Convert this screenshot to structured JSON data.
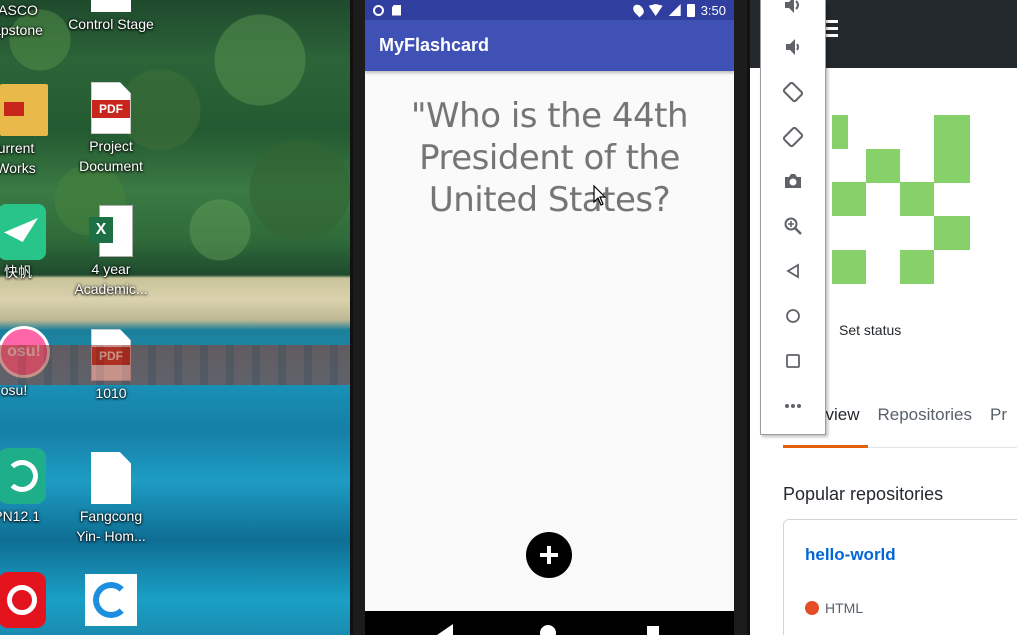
{
  "desktop": {
    "icons": [
      {
        "label": "ASCO\napstone"
      },
      {
        "label": "Control Stage"
      },
      {
        "label": "urrent\nWorks"
      },
      {
        "label": "Project\nDocument"
      },
      {
        "label": "快帆"
      },
      {
        "label": "4 year\nAcademic..."
      },
      {
        "label": "osu!"
      },
      {
        "label": "1010"
      },
      {
        "label": "VPN12.1"
      },
      {
        "label": "Fangcong\nYin- Hom..."
      },
      {
        "label": "PDF"
      }
    ]
  },
  "phone": {
    "status_time": "3:50",
    "app_title": "MyFlashcard",
    "question": "\"Who is the 44th President of the United States?",
    "colors": {
      "status_bar": "#303f9f",
      "app_bar": "#3f51b5",
      "fab": "#000000"
    }
  },
  "emulator_toolbar": {
    "buttons": [
      "volume-up-icon",
      "volume-down-icon",
      "rotate-left-icon",
      "rotate-right-icon",
      "camera-icon",
      "zoom-icon",
      "back-icon",
      "home-icon",
      "overview-icon",
      "more-icon"
    ]
  },
  "github": {
    "set_status": "Set status",
    "tabs": [
      "rview",
      "Repositories",
      "Pr"
    ],
    "popular_title": "Popular repositories",
    "repo": {
      "name": "hello-world",
      "language": "HTML",
      "language_color": "#e34c26"
    },
    "identicon_color": "#86d169"
  }
}
